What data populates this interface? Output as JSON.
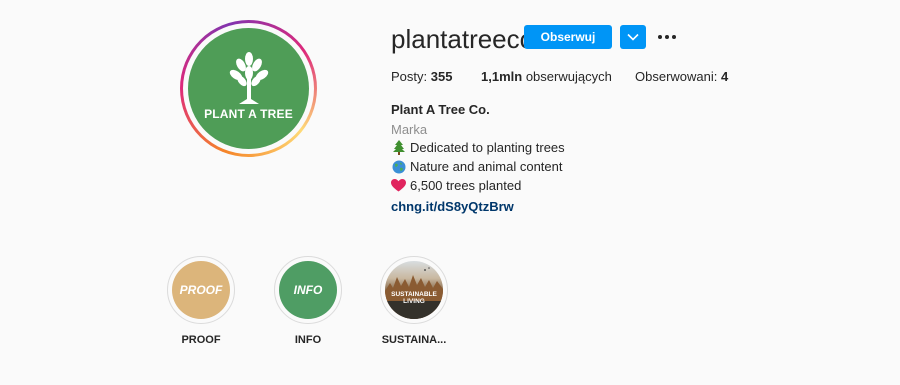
{
  "profile": {
    "username": "plantatreeco",
    "avatar_text": "PLANT A TREE",
    "avatar_color": "#4f9d57",
    "follow_label": "Obserwuj",
    "accent_color": "#0095f6"
  },
  "stats": {
    "posts_label": "Posty:",
    "posts_value": "355",
    "followers_value": "1,1mln",
    "followers_label": "obserwujących",
    "following_label": "Obserwowani:",
    "following_value": "4"
  },
  "bio": {
    "name": "Plant A Tree Co.",
    "category": "Marka",
    "lines": [
      {
        "icon": "evergreen-tree-icon",
        "text": "Dedicated to planting trees"
      },
      {
        "icon": "globe-icon",
        "text": "Nature and animal content"
      },
      {
        "icon": "red-heart-icon",
        "text": "6,500 trees planted"
      }
    ],
    "link": "chng.it/dS8yQtzBrw"
  },
  "highlights": [
    {
      "label": "PROOF",
      "cover_text": "PROOF",
      "color": "#dcb57b"
    },
    {
      "label": "INFO",
      "cover_text": "INFO",
      "color": "#4f9d64"
    },
    {
      "label": "SUSTAINA...",
      "cover_text": "SUSTAINABLE LIVING",
      "color": "#6b5a4a"
    }
  ]
}
